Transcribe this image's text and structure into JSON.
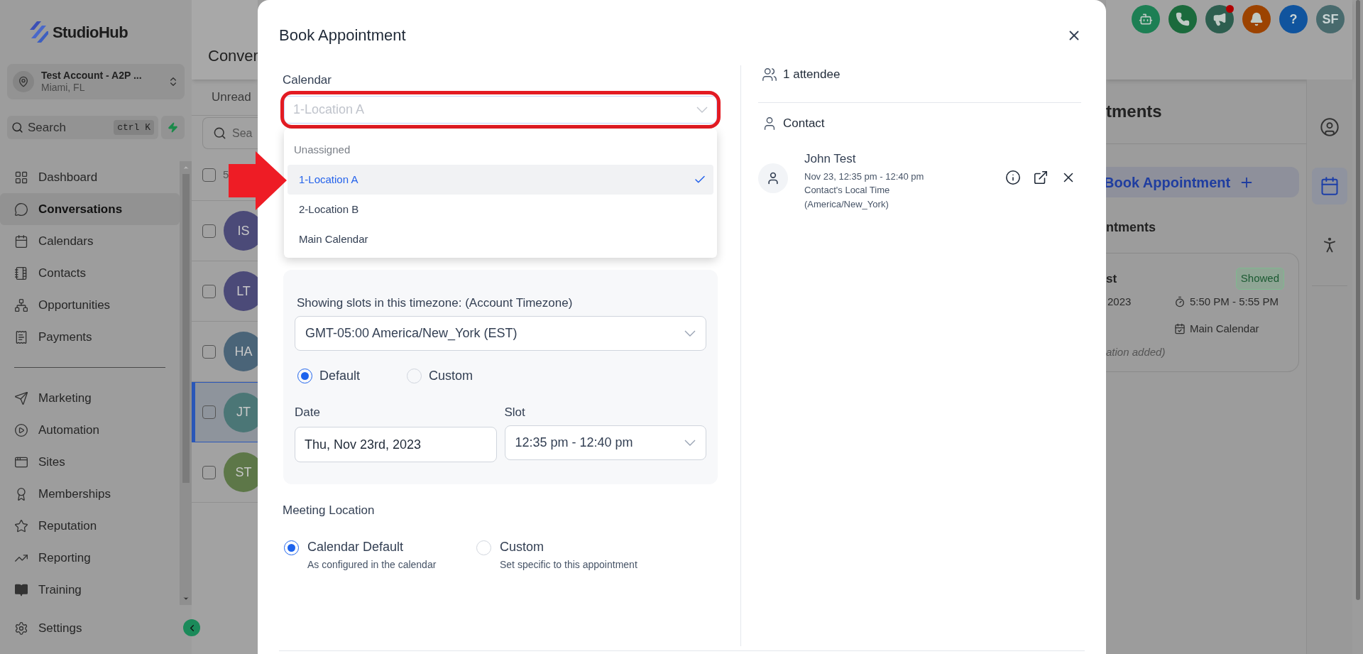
{
  "sidebar": {
    "logo": "StudioHub",
    "account": {
      "name": "Test Account - A2P ...",
      "location": "Miami, FL"
    },
    "search": {
      "placeholder": "Search",
      "shortcut": "ctrl K"
    },
    "nav_groups": [
      {
        "items": [
          {
            "label": "Dashboard",
            "kind": "dashboard",
            "selected": false
          },
          {
            "label": "Conversations",
            "kind": "conversations",
            "selected": true
          },
          {
            "label": "Calendars",
            "kind": "calendars",
            "selected": false
          },
          {
            "label": "Contacts",
            "kind": "contacts",
            "selected": false
          },
          {
            "label": "Opportunities",
            "kind": "opportunities",
            "selected": false
          },
          {
            "label": "Payments",
            "kind": "payments",
            "selected": false
          }
        ]
      },
      {
        "items": [
          {
            "label": "Marketing",
            "kind": "marketing",
            "selected": false
          },
          {
            "label": "Automation",
            "kind": "automation",
            "selected": false
          },
          {
            "label": "Sites",
            "kind": "sites",
            "selected": false
          },
          {
            "label": "Memberships",
            "kind": "memberships",
            "selected": false
          },
          {
            "label": "Reputation",
            "kind": "reputation",
            "selected": false
          },
          {
            "label": "Reporting",
            "kind": "reporting",
            "selected": false
          },
          {
            "label": "Training",
            "kind": "training",
            "selected": false
          }
        ]
      }
    ],
    "settings": "Settings"
  },
  "conversations": {
    "title": "Conver",
    "tabs": [
      {
        "label": "Unread"
      }
    ],
    "search": {
      "placeholder": "Sea"
    },
    "select_all": {
      "checked": false,
      "count": "5"
    },
    "rows": [
      {
        "initials": "IS",
        "color": "#4b4a78",
        "checked": false,
        "selected": false
      },
      {
        "initials": "LT",
        "color": "#4b4a78",
        "checked": false,
        "selected": false
      },
      {
        "initials": "HA",
        "color": "#4a6478",
        "checked": false,
        "selected": false
      },
      {
        "initials": "JT",
        "color": "#4b7676",
        "checked": false,
        "selected": true
      },
      {
        "initials": "ST",
        "color": "#5d7748",
        "checked": false,
        "selected": false
      }
    ]
  },
  "header_actions": [
    {
      "kind": "robot",
      "color": "#1d7f54",
      "badge": false
    },
    {
      "kind": "phone",
      "color": "#1b6a3c",
      "badge": false
    },
    {
      "kind": "megaphone",
      "color": "#2d5e4f",
      "badge": true
    },
    {
      "kind": "bell",
      "color": "#9c4300",
      "badge": false
    },
    {
      "kind": "help",
      "color": "#10549e",
      "badge": false,
      "text": "?"
    },
    {
      "kind": "avatar",
      "color": "#486a6d",
      "badge": false,
      "text": "SF"
    }
  ],
  "appointments_panel": {
    "title": "tments",
    "book_button": "Book Appointment",
    "section": "ntments",
    "card": {
      "name": "st",
      "status": "Showed",
      "date": "2023",
      "time": "5:50 PM - 5:55 PM",
      "calendar": "Main Calendar",
      "note": "ation added)"
    }
  },
  "right_rail": [
    {
      "kind": "contact",
      "selected": false
    },
    {
      "kind": "calendar",
      "selected": true
    },
    {
      "kind": "people",
      "selected": false
    }
  ],
  "modal": {
    "title": "Book Appointment",
    "calendar": {
      "label": "Calendar",
      "value": "1-Location A",
      "expanded": true,
      "options": [
        {
          "label": "Unassigned",
          "disabled": true,
          "selected": false
        },
        {
          "label": "1-Location A",
          "disabled": false,
          "selected": true
        },
        {
          "label": "2-Location B",
          "disabled": false,
          "selected": false
        },
        {
          "label": "Main Calendar",
          "disabled": false,
          "selected": false
        }
      ]
    },
    "timezone": {
      "label": "Showing slots in this timezone: (Account Timezone)",
      "value": "GMT-05:00 America/New_York (EST)"
    },
    "slot_mode": [
      {
        "label": "Default",
        "selected": true
      },
      {
        "label": "Custom",
        "selected": false
      }
    ],
    "date": {
      "label": "Date",
      "value": "Thu, Nov 23rd, 2023"
    },
    "slot": {
      "label": "Slot",
      "value": "12:35 pm - 12:40 pm"
    },
    "meeting_location": {
      "label": "Meeting Location",
      "options": [
        {
          "label": "Calendar Default",
          "description": "As configured in the calendar",
          "selected": true
        },
        {
          "label": "Custom",
          "description": "Set specific to this appointment",
          "selected": false
        }
      ]
    },
    "attendees": {
      "count": "1 attendee",
      "section": "Contact",
      "contacts": [
        {
          "name": "John Test",
          "time": "Nov 23, 12:35 pm - 12:40 pm",
          "note": "Contact's Local Time (America/New_York)"
        }
      ]
    }
  }
}
